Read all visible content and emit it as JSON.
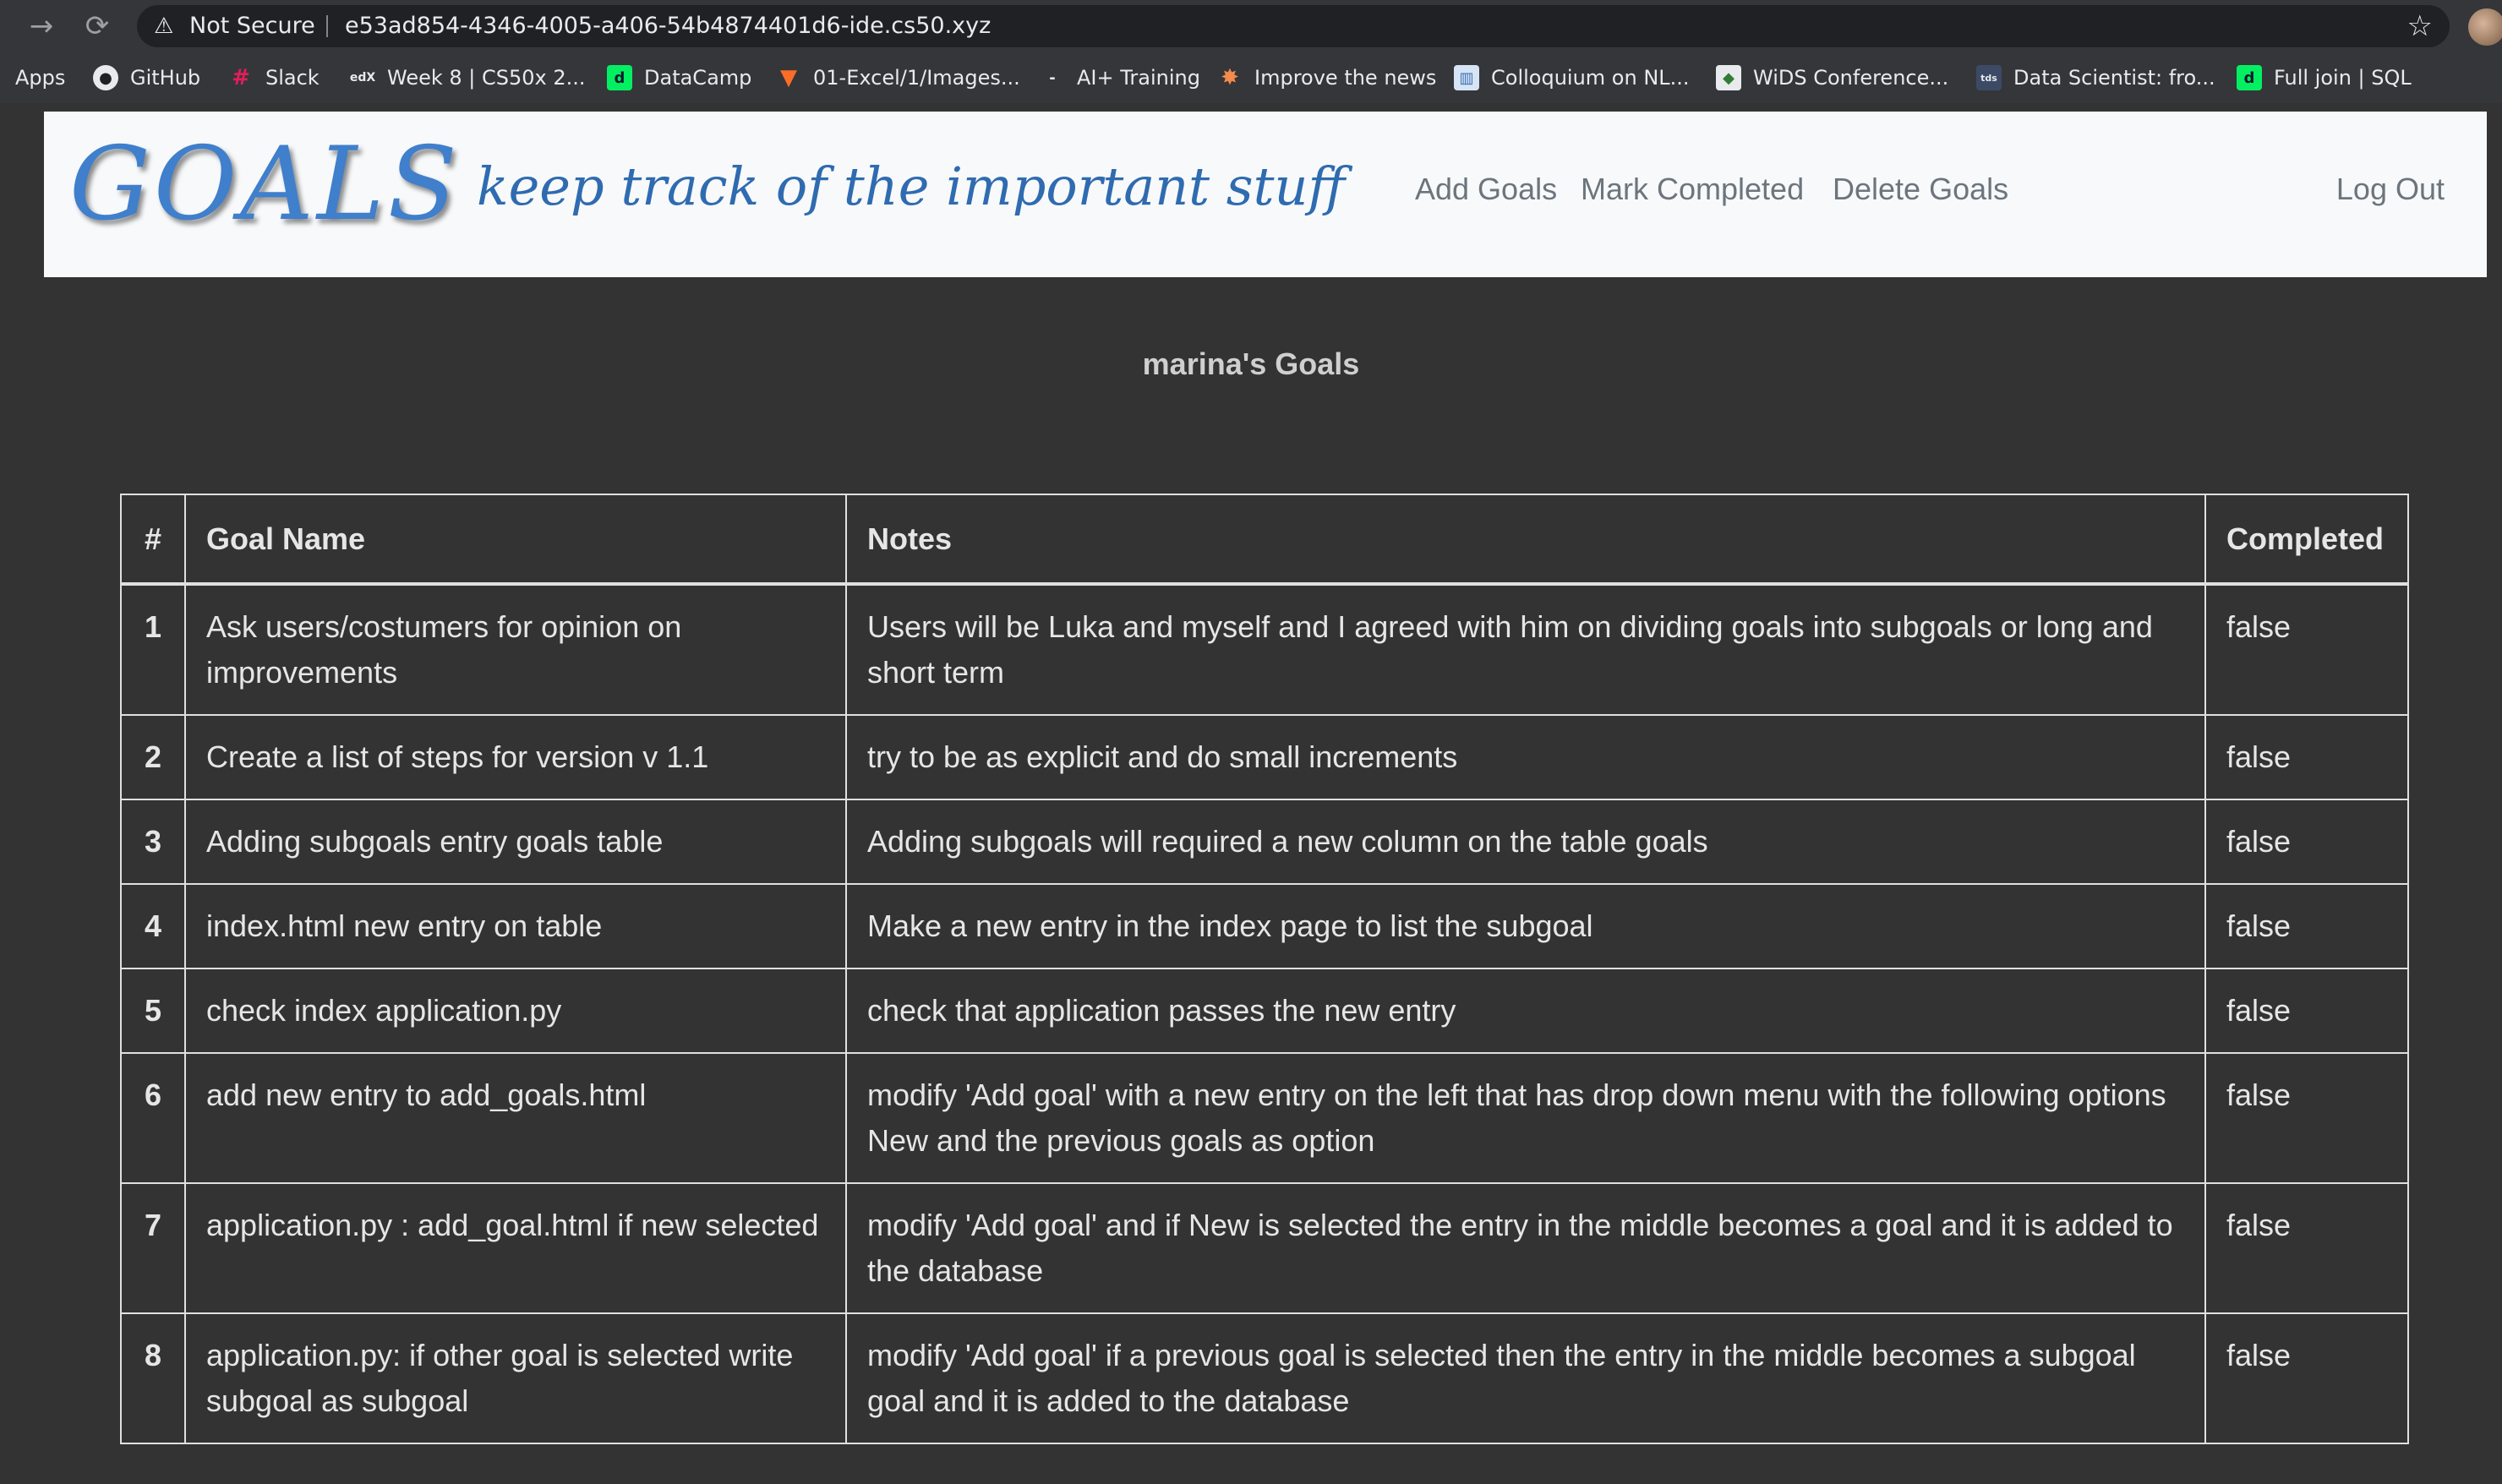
{
  "browser": {
    "security_label": "Not Secure",
    "url": "e53ad854-4346-4005-a406-54b4874401d6-ide.cs50.xyz",
    "bookmarks": [
      {
        "label": "Apps",
        "icon": "apps-icon"
      },
      {
        "label": "GitHub",
        "icon": "github-icon"
      },
      {
        "label": "Slack",
        "icon": "slack-icon"
      },
      {
        "label": "Week 8 | CS50x 2...",
        "icon": "edx-icon"
      },
      {
        "label": "DataCamp",
        "icon": "datacamp-icon"
      },
      {
        "label": "01-Excel/1/Images...",
        "icon": "gitlab-icon"
      },
      {
        "label": "AI+ Training",
        "icon": "ai-training-icon"
      },
      {
        "label": "Improve the news",
        "icon": "improve-news-icon"
      },
      {
        "label": "Colloquium on NL...",
        "icon": "colloquium-icon"
      },
      {
        "label": "WiDS Conference...",
        "icon": "wids-icon"
      },
      {
        "label": "Data Scientist: fro...",
        "icon": "tds-icon"
      },
      {
        "label": "Full join | SQL",
        "icon": "datacamp-icon"
      }
    ]
  },
  "header": {
    "brand": "GOALS",
    "tagline": "keep track of the important stuff",
    "nav": {
      "add_goals": "Add Goals",
      "mark_completed": "Mark Completed",
      "delete_goals": "Delete Goals",
      "log_out": "Log Out"
    }
  },
  "main": {
    "title": "marina's Goals",
    "table": {
      "columns": [
        "#",
        "Goal Name",
        "Notes",
        "Completed"
      ],
      "rows": [
        {
          "num": "1",
          "goal": "Ask users/costumers for opinion on improvements",
          "notes": "Users will be Luka and myself and I agreed with him on dividing goals into subgoals or long and short term",
          "completed": "false"
        },
        {
          "num": "2",
          "goal": "Create a list of steps for version v 1.1",
          "notes": "try to be as explicit and do small increments",
          "completed": "false"
        },
        {
          "num": "3",
          "goal": "Adding subgoals entry goals table",
          "notes": "Adding subgoals will required a new column on the table goals",
          "completed": "false"
        },
        {
          "num": "4",
          "goal": "index.html new entry on table",
          "notes": "Make a new entry in the index page to list the subgoal",
          "completed": "false"
        },
        {
          "num": "5",
          "goal": "check index application.py",
          "notes": "check that application passes the new entry",
          "completed": "false"
        },
        {
          "num": "6",
          "goal": "add new entry to add_goals.html",
          "notes": "modify 'Add goal' with a new entry on the left that has drop down menu with the following options New and the previous goals as option",
          "completed": "false"
        },
        {
          "num": "7",
          "goal": "application.py : add_goal.html if new selected",
          "notes": "modify 'Add goal' and if New is selected the entry in the middle becomes a goal and it is added to the database",
          "completed": "false"
        },
        {
          "num": "8",
          "goal": "application.py: if other goal is selected write subgoal as subgoal",
          "notes": "modify 'Add goal' if a previous goal is selected then the entry in the middle becomes a subgoal goal and it is added to the database",
          "completed": "false"
        }
      ]
    }
  }
}
